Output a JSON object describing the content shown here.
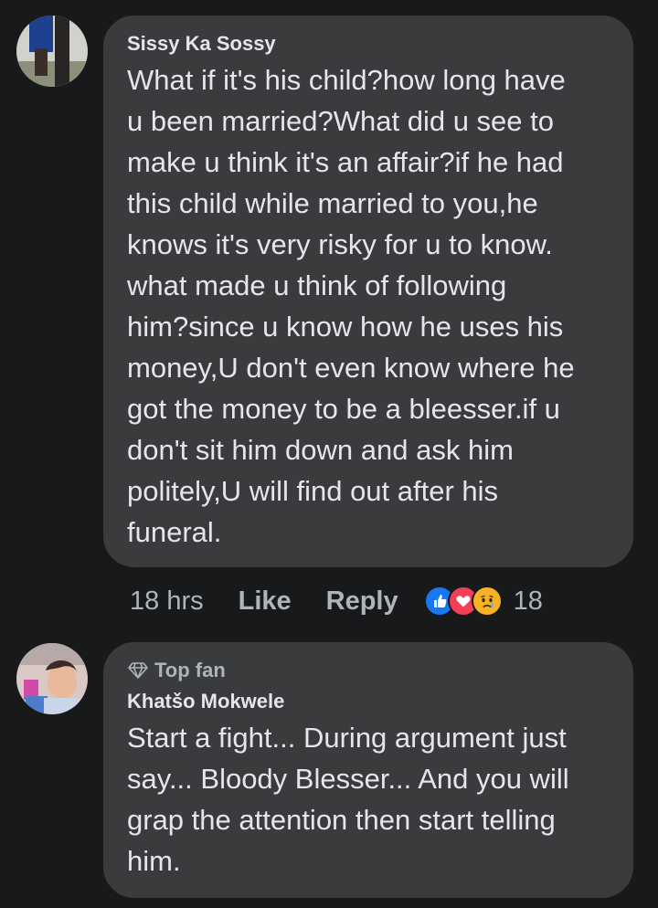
{
  "comments": [
    {
      "author": "Sissy Ka Sossy",
      "text": "What if it's his child?how long have\nu been married?What did u see to\nmake u think it's an affair?if he had\nthis child while married to you,he\nknows it's very risky for u to know.\nwhat made u think of following\nhim?since u know how he uses his\nmoney,U don't even know where he\ngot the money to be a bleesser.if u\ndon't sit him down and ask him\npolitely,U will find out after his\nfuneral.",
      "time": "18 hrs",
      "like_label": "Like",
      "reply_label": "Reply",
      "reaction_count": "18",
      "reactions": [
        "like-icon",
        "love-icon",
        "sad-icon"
      ]
    },
    {
      "badge": "Top fan",
      "author": "Khatšo Mokwele",
      "text": "Start a fight... During argument just\nsay... Bloody Blesser... And you will\ngrap the attention then start telling\nhim."
    }
  ],
  "colors": {
    "background": "#18191a",
    "bubble": "#3a3b3c",
    "text": "#e4e6eb",
    "secondary_text": "#b0b3b8",
    "like_blue": "#1877f2",
    "love_red": "#f33e58",
    "sad_yellow": "#f7b125"
  }
}
